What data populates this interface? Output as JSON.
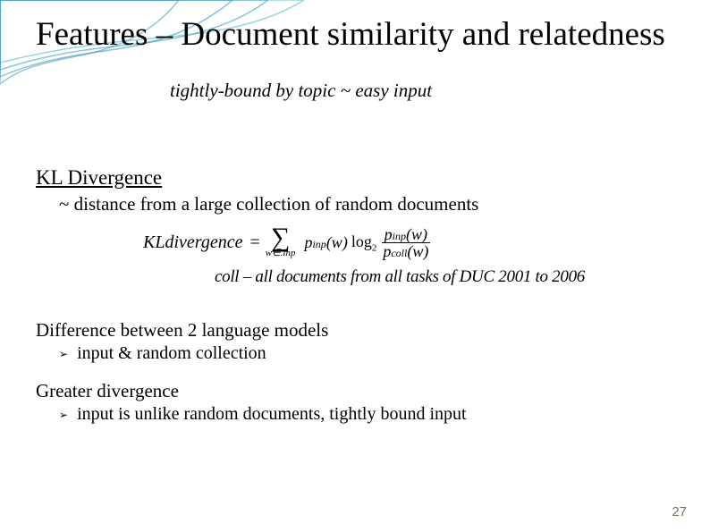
{
  "title": "Features – Document similarity and relatedness",
  "subtitle": "tightly-bound by topic ~ easy input",
  "section_heading": "KL Divergence",
  "section_sub": "~ distance from a large collection of random documents",
  "formula": {
    "label": "KLdivergence",
    "equals": "=",
    "sigma": "∑",
    "sum_sub": "w∈.inp",
    "p_inp_w": "p",
    "p_inp_sub": "inp",
    "p_inp_arg": "(w)",
    "log": "log",
    "log_base": "2",
    "num_p": "p",
    "num_sub": "inp",
    "num_arg": "(w)",
    "den_p": "p",
    "den_sub": "coll",
    "den_arg": "(w)"
  },
  "coll_note": "coll – all documents from all tasks of DUC 2001 to 2006",
  "diff_heading": "Difference between 2 language models",
  "diff_bullet": "input & random collection",
  "greater_heading": "Greater divergence",
  "greater_bullet": "input is unlike random documents, tightly bound input",
  "page_number": "27",
  "bullet_glyph": "➢"
}
